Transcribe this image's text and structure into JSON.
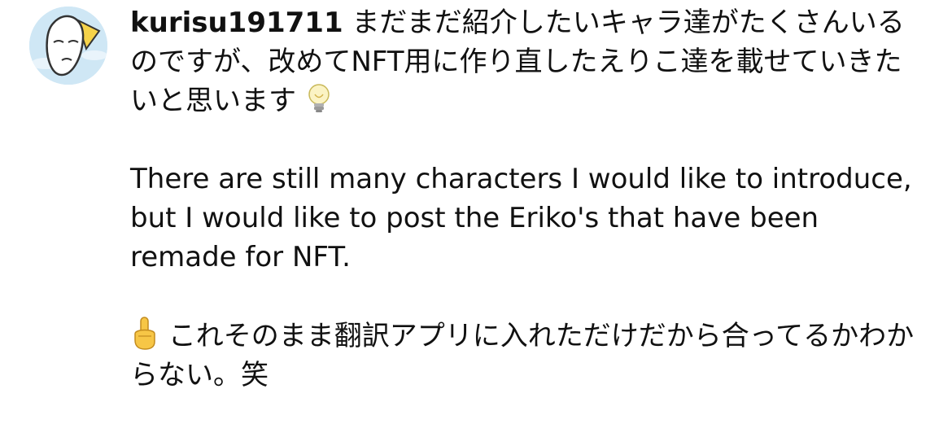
{
  "comment": {
    "username": "kurisu191711",
    "japanese_text": "まだまだ紹介したいキャラ達がたくさんいるのですが、改めてNFT用に作り直したえりこ達を載せていきたいと思います",
    "english_text": "There are still many characters I would like to introduce, but I would like to post the Eriko's that have been remade for NFT.",
    "note_text": "これそのまま翻訳アプリに入れただけだから合ってるかわからない。笑",
    "icons": {
      "avatar": "character-avatar",
      "bulb": "light-bulb-emoji",
      "pointing": "pointing-up-emoji"
    }
  }
}
